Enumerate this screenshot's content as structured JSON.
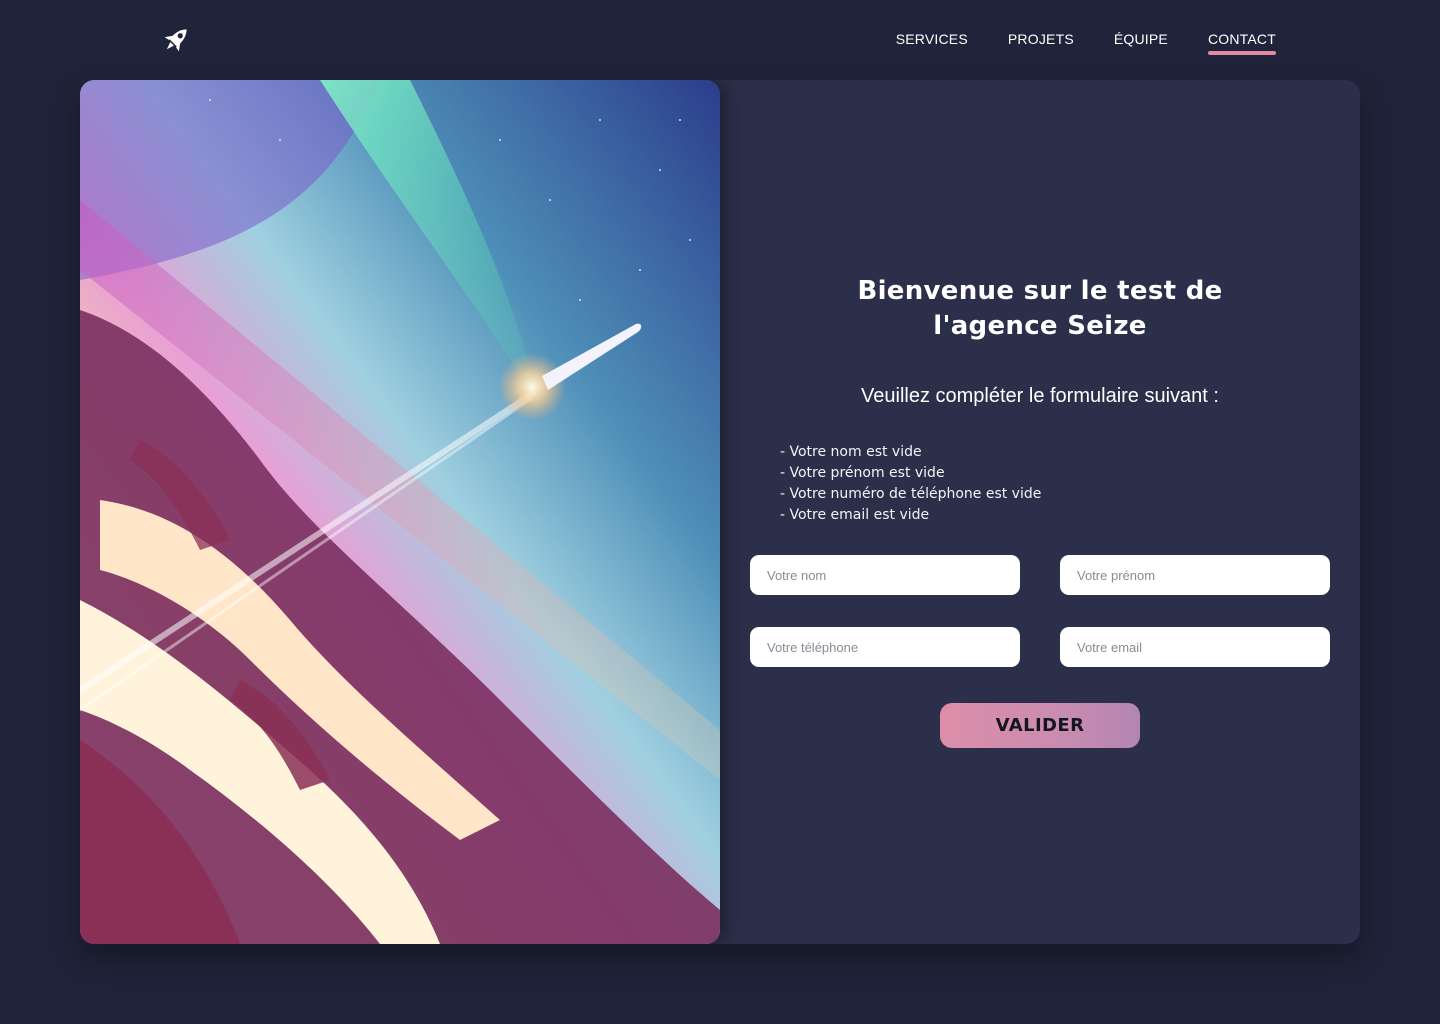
{
  "header": {
    "logo_icon": "rocket-icon",
    "nav": [
      {
        "label": "SERVICES",
        "active": false
      },
      {
        "label": "PROJETS",
        "active": false
      },
      {
        "label": "ÉQUIPE",
        "active": false
      },
      {
        "label": "CONTACT",
        "active": true
      }
    ]
  },
  "hero": {
    "image_subject": "rocket-launch-over-planet-illustration"
  },
  "form": {
    "title_line1": "Bienvenue sur le test de",
    "title_line2": "l'agence Seize",
    "subtitle": "Veuillez compléter le formulaire suivant :",
    "errors": [
      "- Votre nom est vide",
      "- Votre prénom est vide",
      "- Votre numéro de téléphone est vide",
      "- Votre email est vide"
    ],
    "fields": {
      "last_name": {
        "value": "",
        "placeholder": "Votre nom"
      },
      "first_name": {
        "value": "",
        "placeholder": "Votre prénom"
      },
      "phone": {
        "value": "",
        "placeholder": "Votre téléphone"
      },
      "email": {
        "value": "",
        "placeholder": "Votre email"
      }
    },
    "submit_label": "VALIDER"
  },
  "colors": {
    "page_background": "#20243a",
    "card_background": "#2c2f4a",
    "accent": "#e58aa4",
    "button_gradient_start": "#dd8ea8",
    "button_gradient_end": "#b385b4"
  }
}
